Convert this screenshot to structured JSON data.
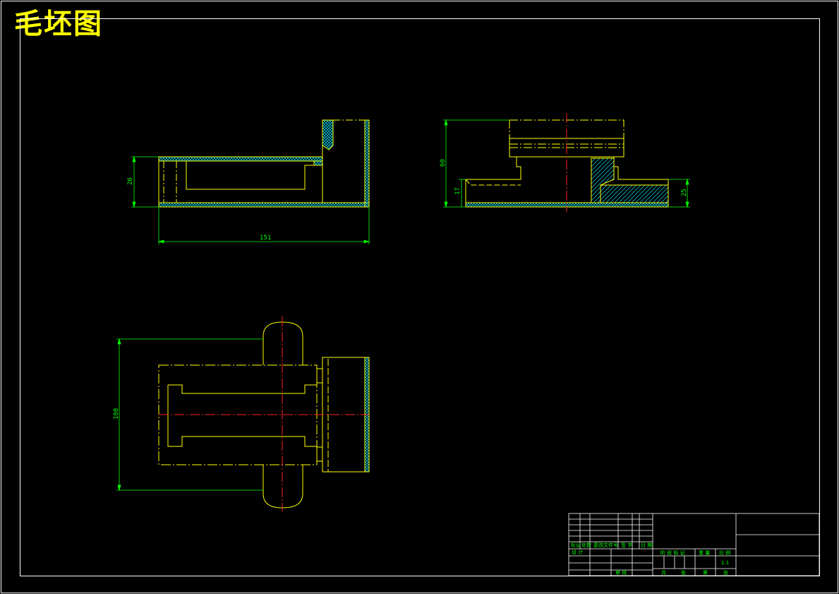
{
  "title": "毛坯图",
  "dimensions": {
    "front_length": "151",
    "front_height": "26",
    "side_total_height": "60",
    "side_step_height": "17",
    "side_right_height": "25",
    "plan_height": "108"
  },
  "title_block": {
    "row_labels": [
      "标记",
      "处数",
      "更改文件号",
      "签 字",
      "日 期"
    ],
    "design_label": "设 计",
    "stage_labels": [
      "阶 段 标 记",
      "重 量",
      "比 例"
    ],
    "scale_value": "1:1",
    "review_label": "审 核",
    "bottom_labels": [
      "共",
      "张",
      "第",
      "张"
    ]
  },
  "colors": {
    "outline": "#ffff00",
    "dimension": "#00ff00",
    "hatch": "#00e5ff",
    "centerline": "#ff2020",
    "frame": "#ffffff"
  }
}
